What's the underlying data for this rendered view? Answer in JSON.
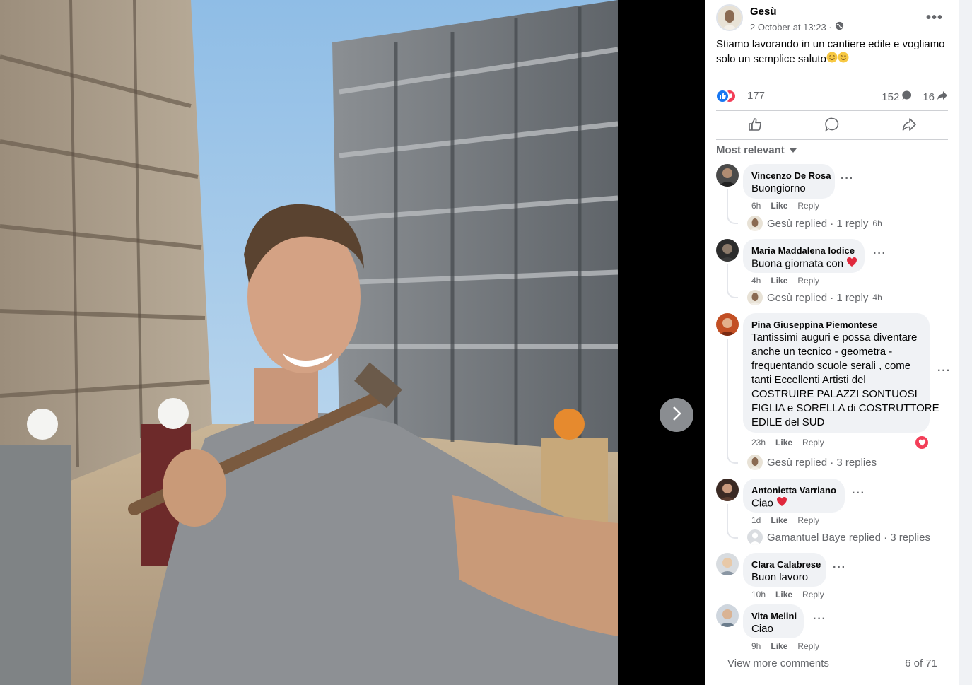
{
  "post": {
    "author": "Gesù",
    "timestamp": "2 October at 13:23 ·",
    "privacy_icon": "globe-icon",
    "text": "Stiamo lavorando in un cantiere edile e vogliamo solo un semplice saluto",
    "reactions_count": "177",
    "comments_count": "152",
    "shares_count": "16"
  },
  "actions": {
    "like_icon": "thumbs-up-icon",
    "comment_icon": "comment-icon",
    "share_icon": "share-icon"
  },
  "sort_label": "Most relevant",
  "comments": [
    {
      "name": "Vincenzo De Rosa",
      "text": "Buongiorno",
      "time": "6h",
      "like": "Like",
      "reply": "Reply",
      "replies": {
        "label": "Gesù replied · 1 reply",
        "time": "6h"
      }
    },
    {
      "name": "Maria Maddalena Iodice",
      "text": "Buona giornata con",
      "time": "4h",
      "like": "Like",
      "reply": "Reply",
      "replies": {
        "label": "Gesù replied · 1 reply",
        "time": "4h"
      }
    },
    {
      "name": "Pina Giuseppina Piemontese",
      "lines": [
        "Tantissimi auguri e possa diventare",
        "anche un tecnico - geometra -",
        "frequentando scuole serali , come",
        "tanti Eccellenti Artisti del",
        "COSTRUIRE PALAZZI SONTUOSI",
        "FIGLIA e SORELLA di COSTRUTTORE",
        "EDILE del SUD"
      ],
      "time": "23h",
      "like": "Like",
      "reply": "Reply",
      "replies": {
        "label": "Gesù replied · 3 replies",
        "time": ""
      }
    },
    {
      "name": "Antonietta Varriano",
      "text": "Ciao",
      "time": "1d",
      "like": "Like",
      "reply": "Reply",
      "replies": {
        "label": "Gamantuel Baye replied · 3 replies",
        "time": ""
      }
    },
    {
      "name": "Clara Calabrese",
      "text": "Buon lavoro",
      "time": "10h",
      "like": "Like",
      "reply": "Reply"
    },
    {
      "name": "Vita Melini",
      "text": "Ciao",
      "time": "9h",
      "like": "Like",
      "reply": "Reply"
    }
  ],
  "footer": {
    "view_more": "View more comments",
    "count": "6 of 71"
  },
  "colors": {
    "like_blue": "#1877f2",
    "heart_red": "#f33e58",
    "muted": "#65676b"
  }
}
